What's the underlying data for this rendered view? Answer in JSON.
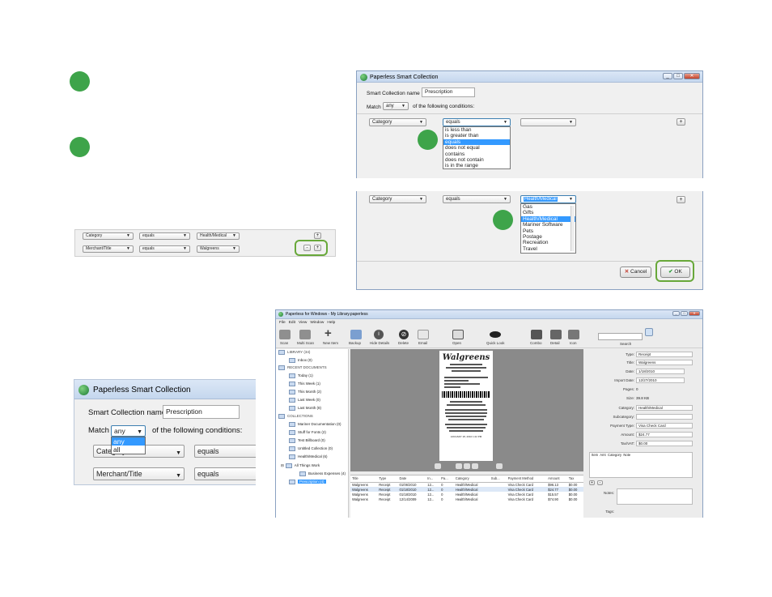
{
  "dialog_main": {
    "title": "Paperless Smart Collection",
    "name_label": "Smart Collection name",
    "name_value": "Prescription",
    "match_label": "Match",
    "match_value": "any",
    "conditions_label": "of the following conditions:",
    "row1": {
      "field": "Category",
      "operator": "equals",
      "value": ""
    },
    "operator_options": [
      "is less than",
      "is greater than",
      "equals",
      "does not equal",
      "contains",
      "does not contain",
      "is in the range"
    ],
    "operator_selected": "equals",
    "plus": "+"
  },
  "dialog_value": {
    "row": {
      "field": "Category",
      "operator": "equals",
      "value": "Health/Medical"
    },
    "value_options": [
      "Gas",
      "Gifts",
      "Health/Medical",
      "Mariner Software",
      "Pets",
      "Postage",
      "Recreation",
      "Travel"
    ],
    "value_selected": "Health/Medical",
    "cancel": "Cancel",
    "ok": "OK",
    "plus": "+"
  },
  "rules_strip": {
    "row1": {
      "field": "Category",
      "operator": "equals",
      "value": "Health/Medical"
    },
    "row2": {
      "field": "Merchant/Title",
      "operator": "equals",
      "value": "Walgreens"
    },
    "minus": "-",
    "plus": "+"
  },
  "zoom_dialog": {
    "title": "Paperless Smart Collection",
    "name_label": "Smart Collection name",
    "name_value": "Prescription",
    "match_label": "Match",
    "match_value": "any",
    "conditions_label": "of the following conditions:",
    "match_options": [
      "any",
      "all"
    ],
    "row1": {
      "field": "Category",
      "operator": "equals"
    },
    "row2": {
      "field": "Merchant/Title",
      "operator": "equals"
    }
  },
  "app": {
    "title": "Paperless for Windows - My Library.paperless",
    "menu": [
      "File",
      "Edit",
      "View",
      "Window",
      "Help"
    ],
    "toolbar": [
      "Scan",
      "Multi Scan",
      "New Item",
      "Backup",
      "Hide Details",
      "Delete",
      "Email",
      "Open",
      "Quick Look",
      "Combo",
      "Detail",
      "Icon"
    ],
    "search_label": "Search",
    "tree": {
      "library": "LIBRARY (34)",
      "inbox": "Inbox (0)",
      "recent_header": "RECENT DOCUMENTS",
      "today": "Today (1)",
      "this_week": "This Week (1)",
      "this_month": "This Month (2)",
      "last_week": "Last Week (0)",
      "last_month": "Last Month (8)",
      "collections_header": "COLLECTIONS",
      "c1": "Mariner Documentation (0)",
      "c2": "Stuff for Fonts (2)",
      "c3": "Test Billboard (0)",
      "c4": "Untitled Collection (0)",
      "c5": "Health/Medical (6)",
      "c6": "All Things Work",
      "c7": "Business Expenses (4)",
      "c8": "Prescription (4)"
    },
    "receipt": {
      "brand": "Walgreens",
      "footer": "JANUARY 18, 2010     1:22 PM"
    },
    "table": {
      "headers": [
        "Title",
        "Type",
        "Date",
        "In...",
        "Pa...",
        "Category",
        "Sub...",
        "Payment Method",
        "Amount",
        "Tax"
      ],
      "rows": [
        [
          "Walgreens",
          "Receipt",
          "01/06/2010",
          "12...",
          "0",
          "Health/Medical",
          "",
          "Visa Check Card",
          "$96.13",
          "$0.00"
        ],
        [
          "Walgreens",
          "Receipt",
          "01/18/2010",
          "12...",
          "0",
          "Health/Medical",
          "",
          "Visa Check Card",
          "$24.77",
          "$0.00"
        ],
        [
          "Walgreens",
          "Receipt",
          "01/18/2010",
          "12...",
          "0",
          "Health/Medical",
          "",
          "Visa Check Card",
          "$15.57",
          "$0.00"
        ],
        [
          "Walgreens",
          "Receipt",
          "12/14/2009",
          "12...",
          "0",
          "Health/Medical",
          "",
          "Visa Check Card",
          "$74.90",
          "$0.00"
        ]
      ]
    },
    "inspector": {
      "type_label": "Type:",
      "type_value": "Receipt",
      "title_label": "Title:",
      "title_value": "Walgreens",
      "date_label": "Date:",
      "date_value": "1/18/2010",
      "import_label": "Import Date:",
      "import_value": "12/27/2010",
      "pages_label": "Pages:",
      "pages_value": "0",
      "size_label": "Size:",
      "size_value": "39.8 KB",
      "category_label": "Category:",
      "category_value": "Health/Medical",
      "subcategory_label": "Subcategory:",
      "subcategory_value": "",
      "payment_label": "Payment Type:",
      "payment_value": "Visa Check Card",
      "amount_label": "Amount:",
      "amount_value": "$24.77",
      "tax_label": "Tax/VAT:",
      "tax_value": "$0.00",
      "items_headers": [
        "Item",
        "Amt",
        "Category",
        "Note"
      ],
      "notes_label": "Notes:",
      "tags_label": "Tags:"
    }
  }
}
